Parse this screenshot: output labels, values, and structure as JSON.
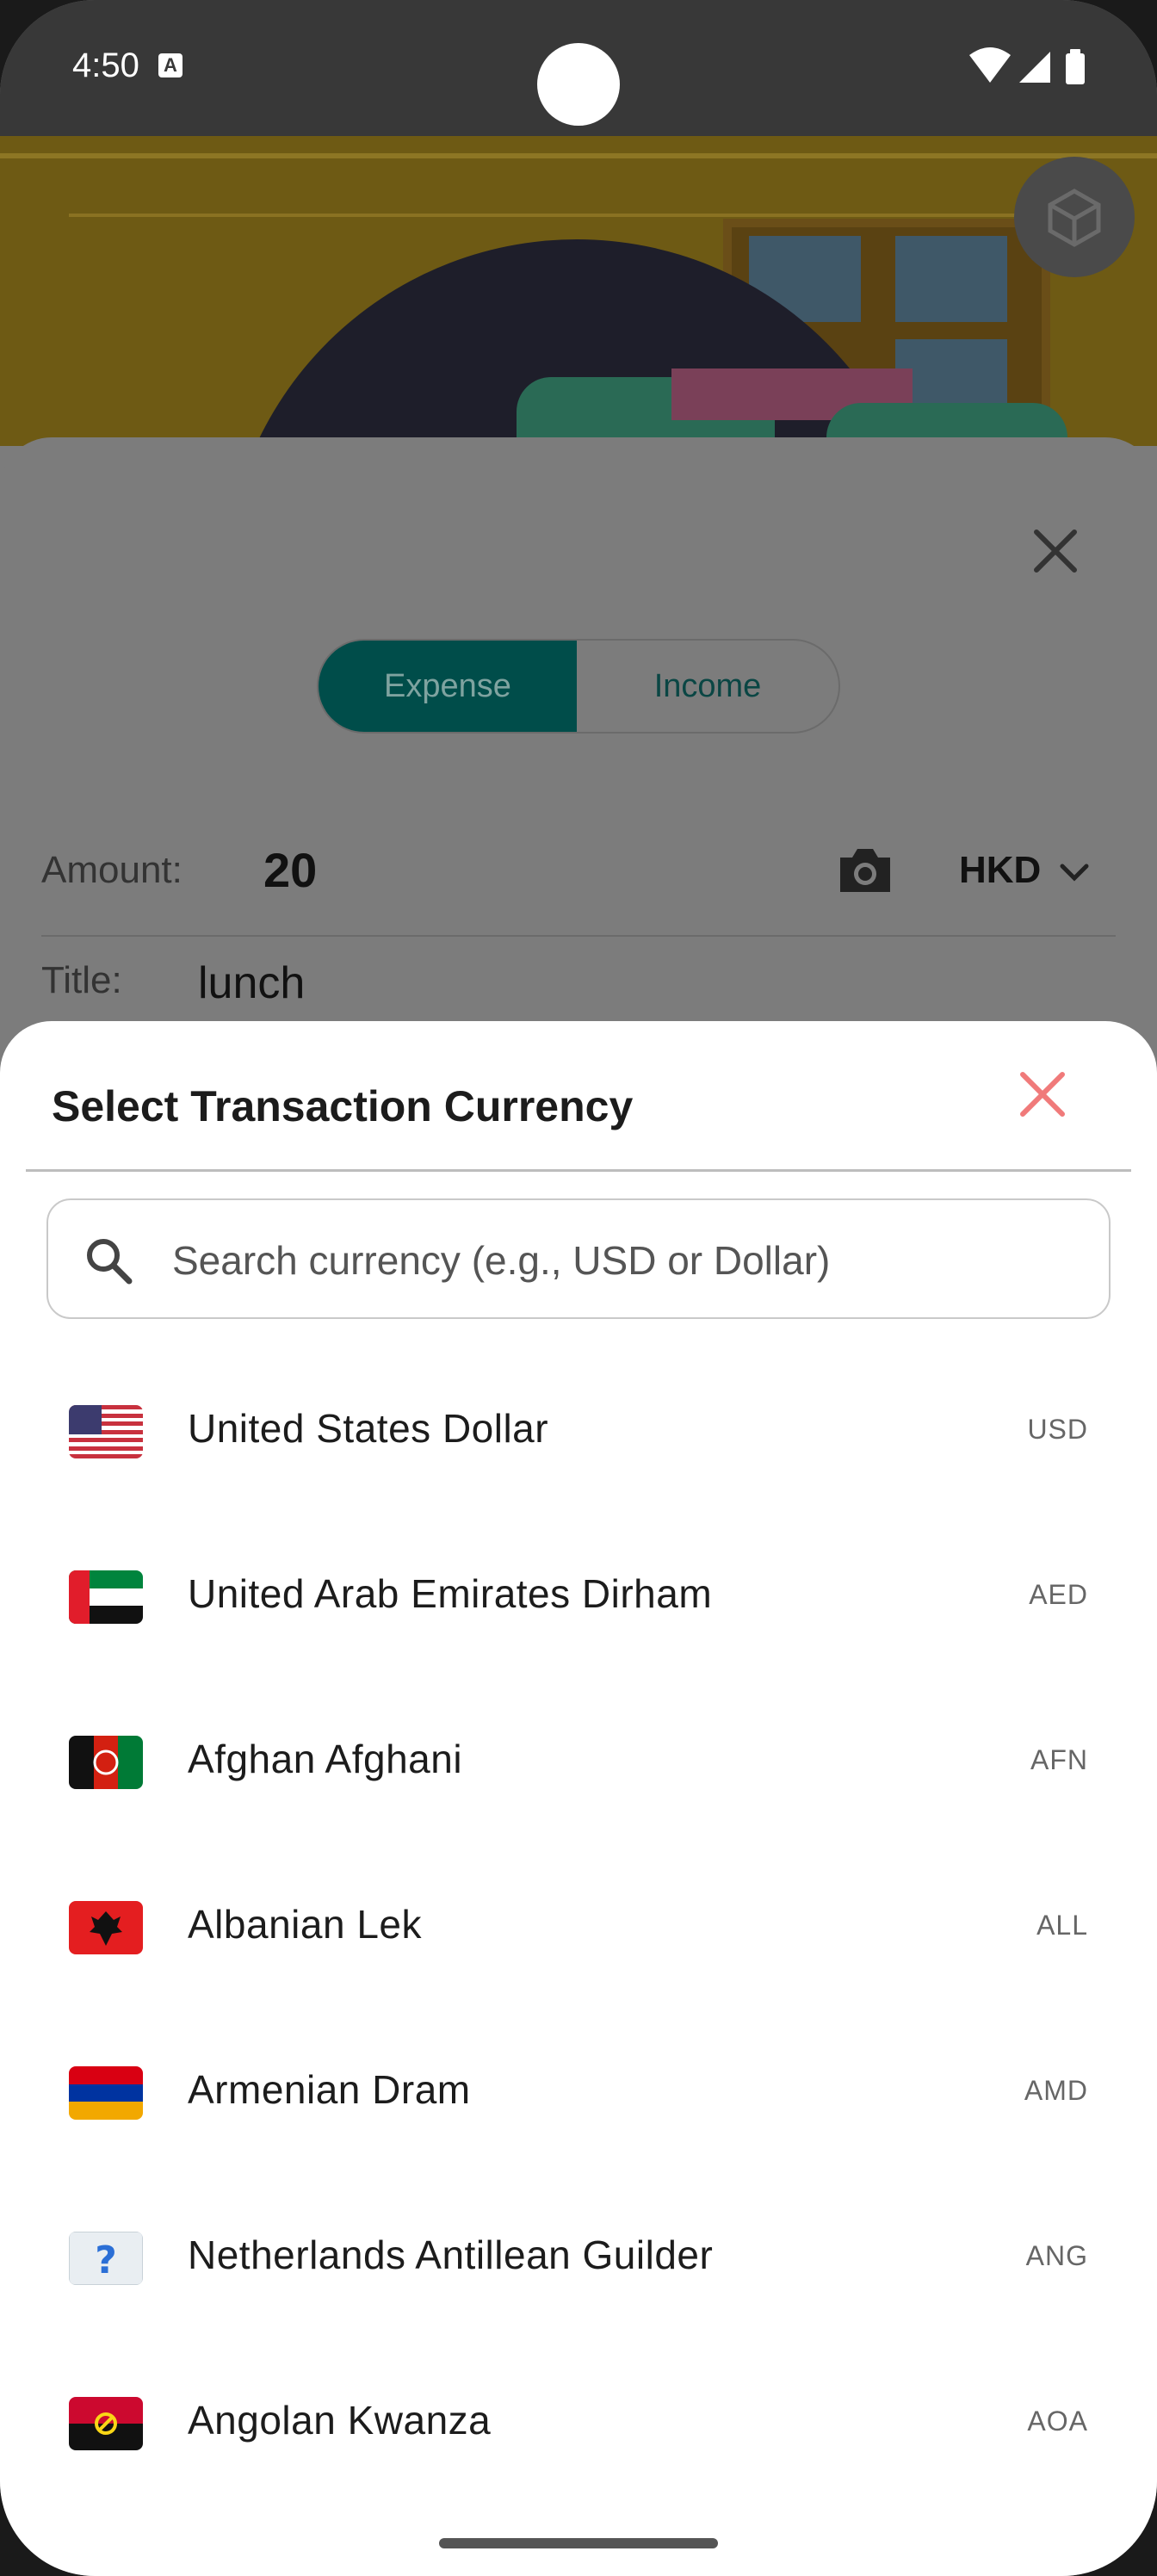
{
  "status_bar": {
    "time": "4:50",
    "notification_icon": "A",
    "icons": [
      "wifi-icon",
      "cellular-signal-icon",
      "battery-icon"
    ]
  },
  "background_panel": {
    "toggle": {
      "expense_label": "Expense",
      "income_label": "Income",
      "selected": "Expense"
    },
    "amount_label": "Amount:",
    "amount_value": "20",
    "currency": "HKD",
    "title_label": "Title:",
    "title_value": "lunch"
  },
  "sheet": {
    "title": "Select Transaction Currency",
    "search_placeholder": "Search currency (e.g., USD or Dollar)",
    "search_value": "",
    "currencies": [
      {
        "name": "United States Dollar",
        "code": "USD",
        "flag": "us-flag"
      },
      {
        "name": "United Arab Emirates Dirham",
        "code": "AED",
        "flag": "ae-flag"
      },
      {
        "name": "Afghan Afghani",
        "code": "AFN",
        "flag": "af-flag"
      },
      {
        "name": "Albanian Lek",
        "code": "ALL",
        "flag": "al-flag"
      },
      {
        "name": "Armenian Dram",
        "code": "AMD",
        "flag": "am-flag"
      },
      {
        "name": "Netherlands Antillean Guilder",
        "code": "ANG",
        "flag": "unknown-flag"
      },
      {
        "name": "Angolan Kwanza",
        "code": "AOA",
        "flag": "ao-flag"
      }
    ]
  },
  "colors": {
    "accent": "#004d4a",
    "close_red": "#f07a7a",
    "scrim": "#7c7c7c"
  }
}
